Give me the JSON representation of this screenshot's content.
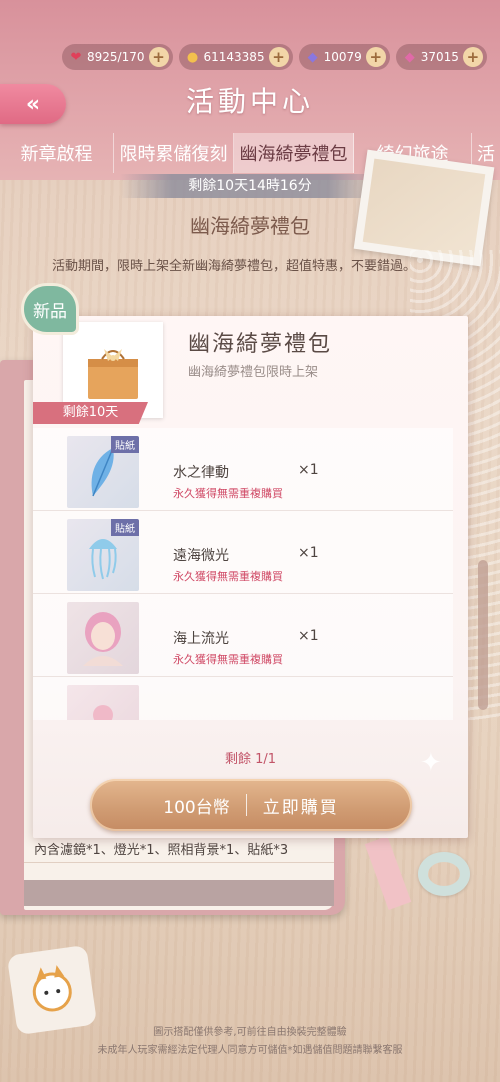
{
  "resources": [
    {
      "icon": "heart-icon",
      "value": "8925/170",
      "color": "#e0405a"
    },
    {
      "icon": "cat-coin-icon",
      "value": "61143385",
      "color": "#f3c04e"
    },
    {
      "icon": "diamond-icon",
      "value": "10079",
      "color": "#8a77e0"
    },
    {
      "icon": "pink-diamond-icon",
      "value": "37015",
      "color": "#e06aa8"
    }
  ],
  "header": {
    "back": "«",
    "title": "活動中心"
  },
  "tabs": [
    {
      "label": "新章啟程"
    },
    {
      "label": "限時累儲復刻"
    },
    {
      "label": "幽海綺夢禮包"
    },
    {
      "label": "綺幻旅途"
    },
    {
      "label": "活"
    }
  ],
  "countdown": "剩餘10天14時16分",
  "section_title": "幽海綺夢禮包",
  "description": "活動期間，限時上架全新幽海綺夢禮包，超值特惠，不要錯過。",
  "new_badge": "新品",
  "pack": {
    "title": "幽海綺夢禮包",
    "subtitle": "幽海綺夢禮包限時上架",
    "remaining": "剩餘10天"
  },
  "items": [
    {
      "tag": "貼紙",
      "name": "水之律動",
      "qty": "×1",
      "note": "永久獲得無需重複購買",
      "icon": "feather-icon"
    },
    {
      "tag": "貼紙",
      "name": "遠海微光",
      "qty": "×1",
      "note": "永久獲得無需重複購買",
      "icon": "jellyfish-icon"
    },
    {
      "tag": "",
      "name": "海上流光",
      "qty": "×1",
      "note": "永久獲得無需重複購買",
      "icon": "hairstyle-icon"
    },
    {
      "tag": "",
      "name": "",
      "qty": "",
      "note": "",
      "icon": "partial-item-icon"
    }
  ],
  "stock": "剩餘 1/1",
  "buy": {
    "price": "100台幣",
    "action": "立即購買"
  },
  "notebook_text": "內含濾鏡*1、燈光*1、照相背景*1、貼紙*3",
  "footer": [
    "圖示搭配僅供參考,可前往自由換裝完整體驗",
    "未成年人玩家需經法定代理人同意方可儲值*如遇儲值問題請聯繫客服"
  ]
}
